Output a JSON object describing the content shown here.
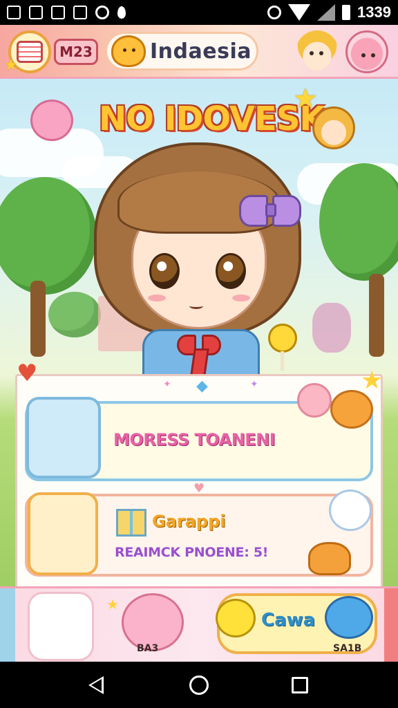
{
  "status_bar": {
    "time": "1339",
    "icons": [
      "gallery-icon",
      "image-icon",
      "instagram-icon",
      "photo-icon",
      "sync-icon",
      "location-icon",
      "alarm-icon",
      "wifi-icon",
      "signal-icon",
      "battery-icon"
    ]
  },
  "header": {
    "level": "M23",
    "title": "Indaesia"
  },
  "game": {
    "title": "NO IDOVESK"
  },
  "panel": {
    "card1": {
      "name": "MORESS TOANENI"
    },
    "card2": {
      "name": "Garappi",
      "subtitle": "REAIMCK PNOENE: 5!"
    }
  },
  "bottom_bar": {
    "pink_label": "BA3",
    "button_label": "Cawa",
    "fish_label": "SA1B"
  },
  "colors": {
    "accent_pink": "#f3a3b6",
    "title_yellow": "#ffc432",
    "card_blue": "#8cc7e6",
    "card_orange": "#f2b5a0"
  }
}
